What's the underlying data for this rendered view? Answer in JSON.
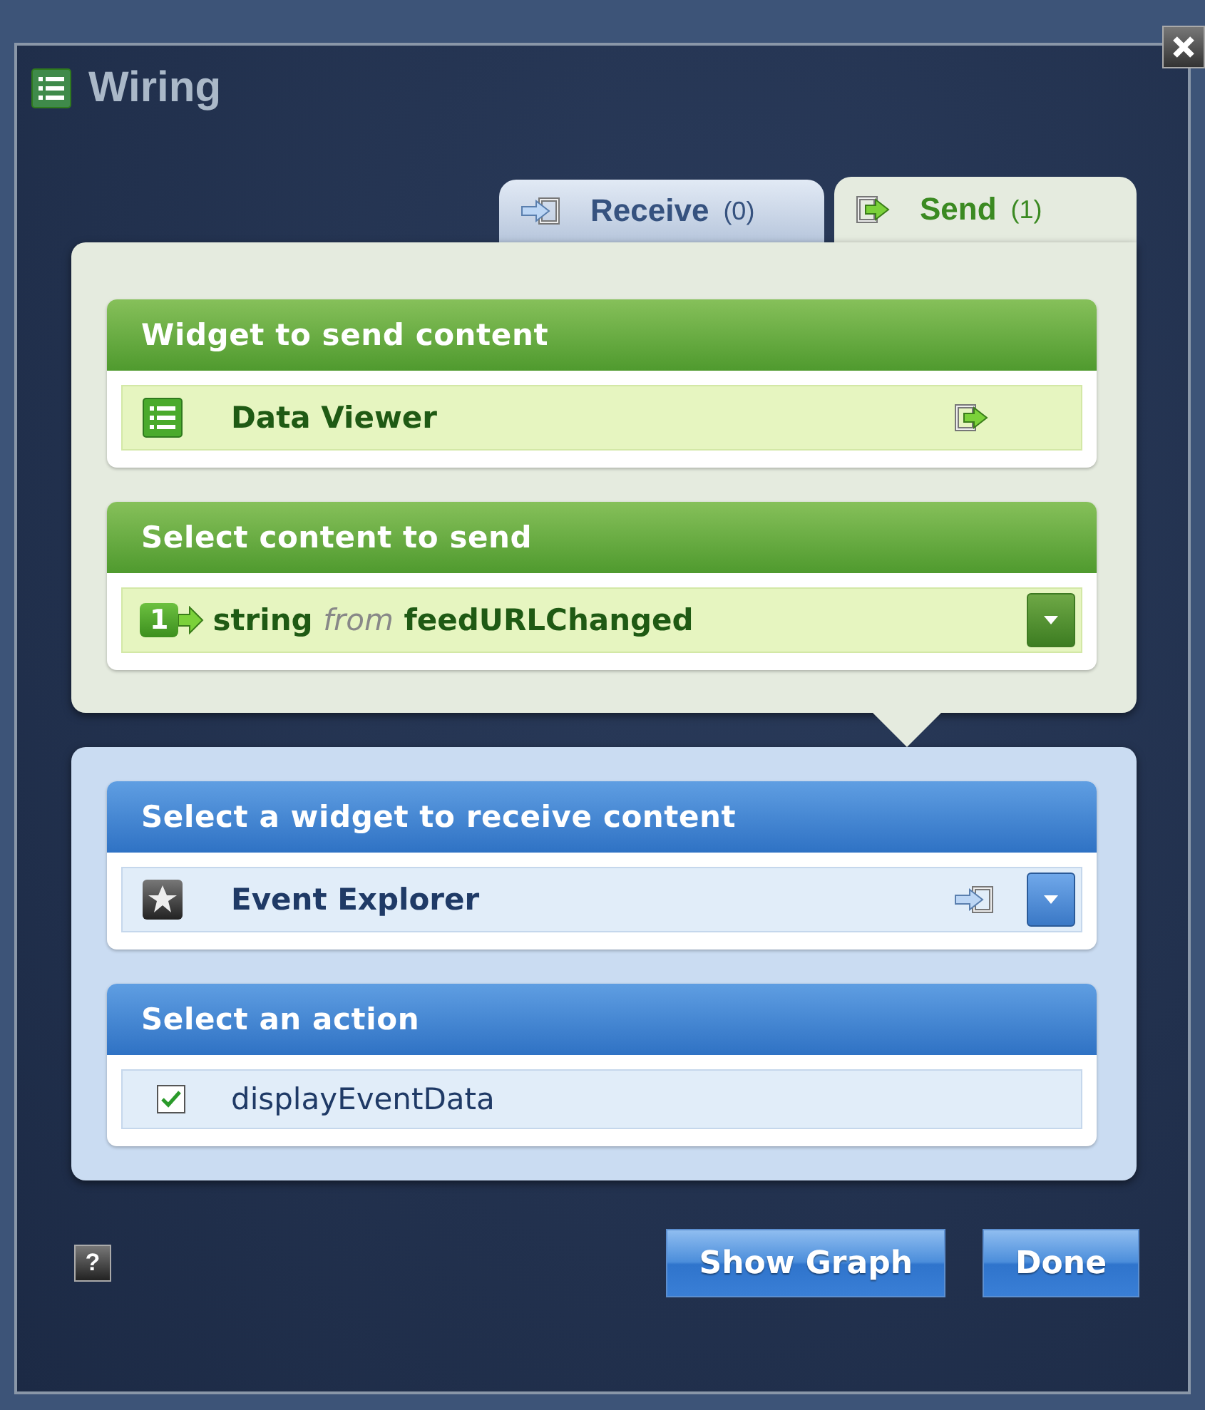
{
  "window": {
    "title": "Wiring"
  },
  "tabs": [
    {
      "label": "Receive",
      "count": "(0)",
      "kind": "receive",
      "selected": false
    },
    {
      "label": "Send",
      "count": "(1)",
      "kind": "send",
      "selected": true
    }
  ],
  "send_panel": {
    "sections": [
      {
        "title": "Widget to send content",
        "kind": "widget",
        "item": {
          "label": "Data Viewer"
        }
      },
      {
        "title": "Select content to send",
        "kind": "content",
        "item": {
          "badge": "1",
          "label": "string *from* feedURLChanged"
        }
      }
    ]
  },
  "receive_panel": {
    "sections": [
      {
        "title": "Select a widget to receive content",
        "kind": "dropdown",
        "item": {
          "label": "Event Explorer"
        }
      },
      {
        "title": "Select an action",
        "kind": "actions",
        "actions": [
          {
            "label": "displayEventData",
            "checked": true
          }
        ]
      }
    ]
  },
  "help": "?",
  "buttons": [
    "Show Graph",
    "Done"
  ]
}
